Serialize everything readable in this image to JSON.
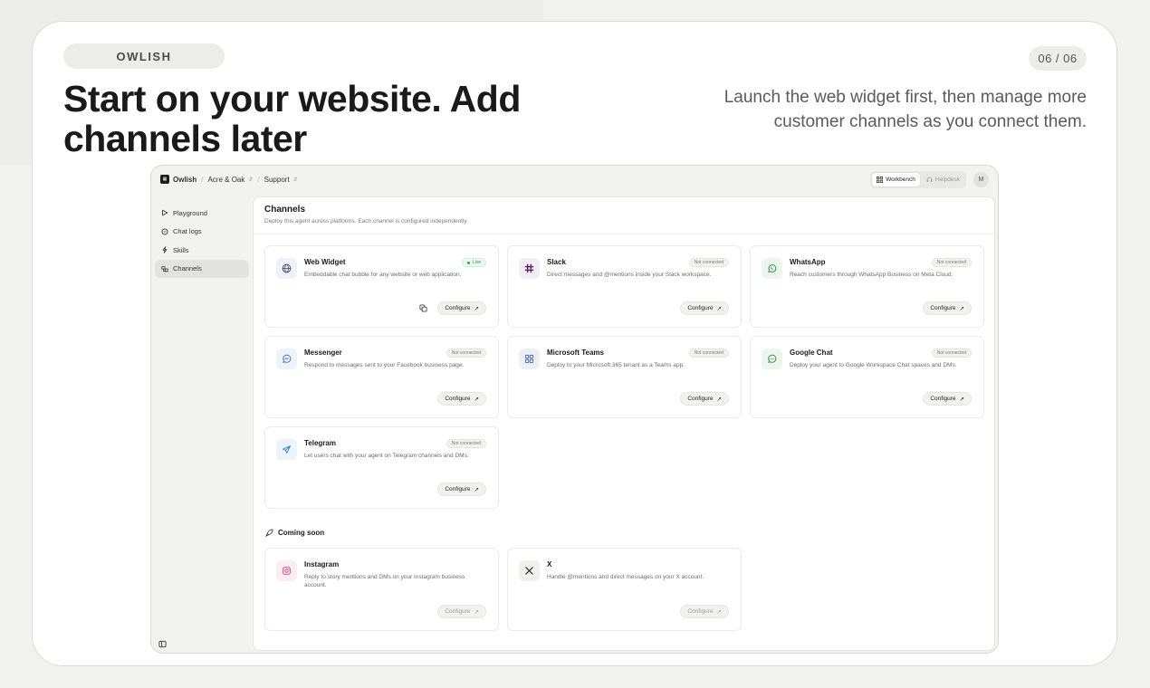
{
  "slide": {
    "brand": "OWLISH",
    "page_indicator": "06 / 06",
    "headline": "Start on your website. Add channels later",
    "subhead": "Launch the web widget first, then manage more customer channels as you connect them."
  },
  "app": {
    "breadcrumb": {
      "logo": "Owlish",
      "workspace": "Acre & Oak",
      "agent": "Support"
    },
    "toggle": {
      "workbench": "Workbench",
      "helpdesk": "Helpdesk"
    },
    "avatar": "M",
    "sidebar": [
      {
        "label": "Playground",
        "icon": "play-icon"
      },
      {
        "label": "Chat logs",
        "icon": "chat-icon"
      },
      {
        "label": "Skills",
        "icon": "bolt-icon"
      },
      {
        "label": "Channels",
        "icon": "channels-icon",
        "active": true
      }
    ],
    "main": {
      "title": "Channels",
      "subtitle": "Deploy this agent across platforms. Each channel is configured independently."
    },
    "channels": [
      {
        "name": "Web Widget",
        "desc": "Embeddable chat bubble for any website or web application.",
        "status": "Live",
        "action": "Configure",
        "icon": "globe-icon"
      },
      {
        "name": "Slack",
        "desc": "Direct messages and @mentions inside your Slack workspace.",
        "status": "Not connected",
        "action": "Configure",
        "icon": "slack-icon"
      },
      {
        "name": "WhatsApp",
        "desc": "Reach customers through WhatsApp Business on Meta Cloud.",
        "status": "Not connected",
        "action": "Configure",
        "icon": "whatsapp-icon"
      },
      {
        "name": "Messenger",
        "desc": "Respond to messages sent to your Facebook business page.",
        "status": "Not connected",
        "action": "Configure",
        "icon": "messenger-icon"
      },
      {
        "name": "Microsoft Teams",
        "desc": "Deploy to your Microsoft 365 tenant as a Teams app.",
        "status": "Not connected",
        "action": "Configure",
        "icon": "teams-icon"
      },
      {
        "name": "Google Chat",
        "desc": "Deploy your agent to Google Workspace Chat spaces and DMs.",
        "status": "Not connected",
        "action": "Configure",
        "icon": "google-chat-icon"
      },
      {
        "name": "Telegram",
        "desc": "Let users chat with your agent on Telegram channels and DMs.",
        "status": "Not connected",
        "action": "Configure",
        "icon": "telegram-icon"
      }
    ],
    "coming_soon": {
      "title": "Coming soon",
      "items": [
        {
          "name": "Instagram",
          "desc": "Reply to story mentions and DMs on your Instagram business account.",
          "action": "Configure",
          "icon": "instagram-icon"
        },
        {
          "name": "X",
          "desc": "Handle @mentions and direct messages on your X account.",
          "action": "Configure",
          "icon": "x-icon"
        }
      ]
    },
    "colors": {
      "live_green": "#2c9a4d",
      "slack_purple": "#5b2d67",
      "whatsapp_green": "#2a8f44",
      "messenger_blue": "#3f6fd1",
      "teams_blue": "#4b64b5",
      "gchat_green": "#2b8a45",
      "telegram_blue": "#2f7fd0",
      "instagram_pink": "#d43f7a"
    }
  }
}
